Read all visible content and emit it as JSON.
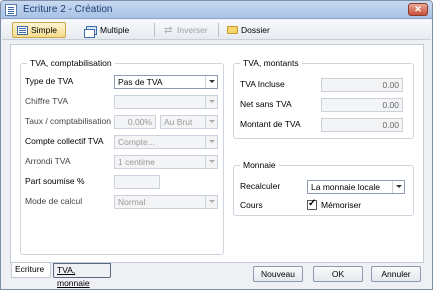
{
  "window": {
    "title": "Ecriture 2 - Création"
  },
  "toolbar": {
    "simple_label": "Simple",
    "multiple_label": "Multiple",
    "inverser_label": "Inverser",
    "dossier_label": "Dossier"
  },
  "tva_compta": {
    "title": "TVA, comptabilisation",
    "type_label": "Type de TVA",
    "type_value": "Pas de TVA",
    "chiffre_label": "Chiffre TVA",
    "chiffre_value": "",
    "taux_label": "Taux / comptabilisation",
    "taux_value": "0.00%",
    "taux_mode": "Au Brut",
    "compte_label": "Compte collectif TVA",
    "compte_value": "Compte...",
    "arrondi_label": "Arrondi TVA",
    "arrondi_value": "1 centime",
    "part_label": "Part soumise %",
    "part_value": "",
    "mode_label": "Mode de calcul",
    "mode_value": "Normal"
  },
  "tva_montants": {
    "title": "TVA, montants",
    "incluse_label": "TVA Incluse",
    "incluse_value": "0.00",
    "net_label": "Net sans TVA",
    "net_value": "0.00",
    "montant_label": "Montant de TVA",
    "montant_value": "0.00"
  },
  "monnaie": {
    "title": "Monnaie",
    "recalculer_label": "Recalculer",
    "recalculer_value": "La monnaie locale",
    "cours_label": "Cours",
    "memoriser_label": "Mémoriser",
    "memoriser_checked": true
  },
  "tabs": {
    "ecriture": "Ecriture",
    "tva_monnaie": "TVA, monnaie"
  },
  "buttons": {
    "nouveau": "Nouveau",
    "ok": "OK",
    "annuler": "Annuler"
  }
}
